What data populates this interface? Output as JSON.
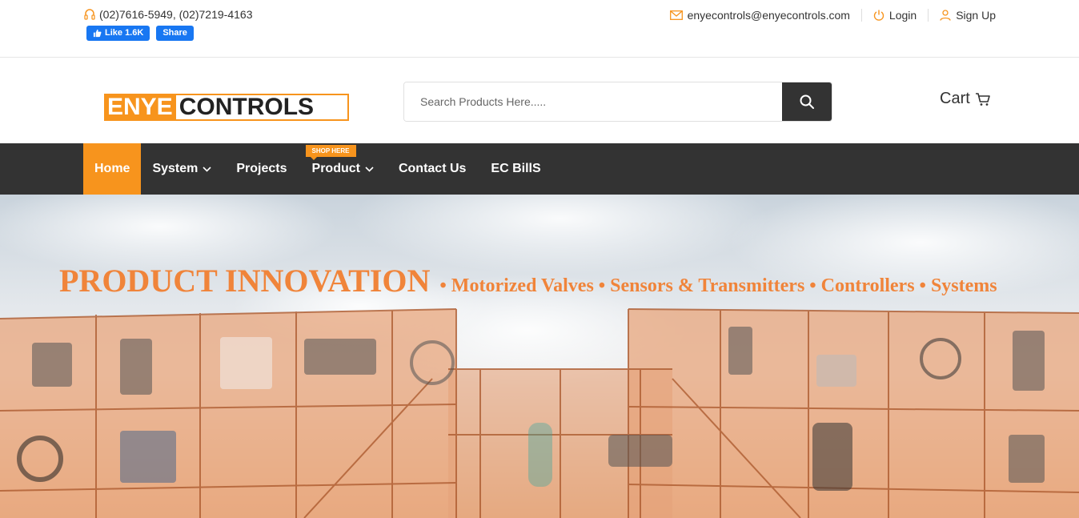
{
  "topbar": {
    "phone": "(02)7616-5949, (02)7219-4163",
    "fb_like_label": "Like 1.6K",
    "fb_share_label": "Share",
    "email": "enyecontrols@enyecontrols.com",
    "login_label": "Login",
    "signup_label": "Sign Up"
  },
  "header": {
    "logo_left": "ENYE",
    "logo_right": "CONTROLS",
    "search_placeholder": "Search Products Here.....",
    "cart_label": "Cart"
  },
  "nav": {
    "items": [
      {
        "label": "Home",
        "active": true,
        "dropdown": false
      },
      {
        "label": "System",
        "active": false,
        "dropdown": true
      },
      {
        "label": "Projects",
        "active": false,
        "dropdown": false
      },
      {
        "label": "Product",
        "active": false,
        "dropdown": true,
        "badge": "SHOP HERE"
      },
      {
        "label": "Contact Us",
        "active": false,
        "dropdown": false
      },
      {
        "label": "EC BillS",
        "active": false,
        "dropdown": false
      }
    ]
  },
  "hero": {
    "title": "PRODUCT INNOVATION",
    "subtitle": "• Motorized Valves • Sensors & Transmitters • Controllers • Systems"
  },
  "colors": {
    "accent": "#f7941d",
    "nav_bg": "#333333",
    "hero_text": "#f0843a"
  }
}
